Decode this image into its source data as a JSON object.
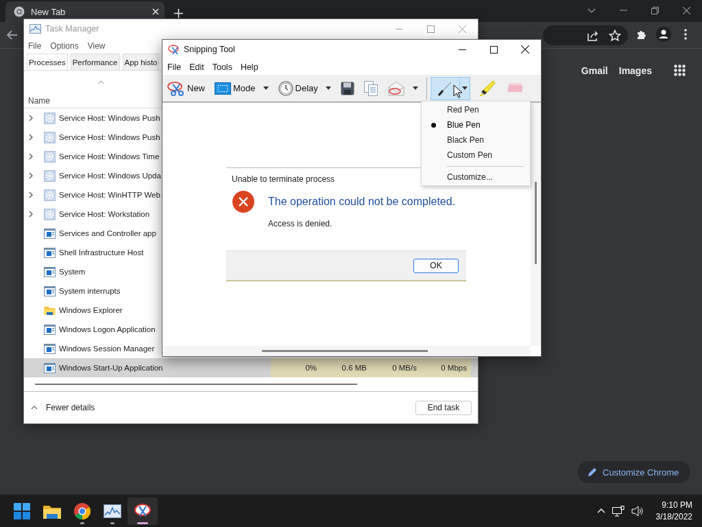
{
  "browser": {
    "tab": {
      "title": "New Tab"
    },
    "links": [
      "Gmail",
      "Images"
    ],
    "customize_button": "Customize Chrome"
  },
  "task_manager": {
    "title": "Task Manager",
    "menu": [
      "File",
      "Options",
      "View"
    ],
    "tabs": [
      {
        "label": "Processes",
        "selected": true
      },
      {
        "label": "Performance",
        "selected": false
      },
      {
        "label": "App histo",
        "selected": false
      }
    ],
    "column": "Name",
    "rows": [
      {
        "name": "Service Host: Windows Push",
        "kind": "service",
        "expandable": true,
        "selected": false
      },
      {
        "name": "Service Host: Windows Push",
        "kind": "service",
        "expandable": true,
        "selected": false
      },
      {
        "name": "Service Host: Windows Time",
        "kind": "service",
        "expandable": true,
        "selected": false
      },
      {
        "name": "Service Host: Windows Upda",
        "kind": "service",
        "expandable": true,
        "selected": false
      },
      {
        "name": "Service Host: WinHTTP Web",
        "kind": "service",
        "expandable": true,
        "selected": false
      },
      {
        "name": "Service Host: Workstation",
        "kind": "service",
        "expandable": true,
        "selected": false
      },
      {
        "name": "Services and Controller app",
        "kind": "app",
        "expandable": false,
        "selected": false
      },
      {
        "name": "Shell Infrastructure Host",
        "kind": "app",
        "expandable": false,
        "selected": false
      },
      {
        "name": "System",
        "kind": "app",
        "expandable": false,
        "selected": false
      },
      {
        "name": "System interrupts",
        "kind": "app",
        "expandable": false,
        "selected": false
      },
      {
        "name": "Windows Explorer",
        "kind": "folder",
        "expandable": false,
        "selected": false
      },
      {
        "name": "Windows Logon Application",
        "kind": "app",
        "expandable": false,
        "selected": false
      },
      {
        "name": "Windows Session Manager",
        "kind": "app",
        "expandable": false,
        "selected": false
      },
      {
        "name": "Windows Start-Up Application",
        "kind": "app",
        "expandable": false,
        "selected": true,
        "values": [
          "0%",
          "0.6 MB",
          "0 MB/s",
          "0 Mbps"
        ]
      }
    ],
    "footer": {
      "toggle": "Fewer details",
      "button": "End task"
    }
  },
  "snipping_tool": {
    "title": "Snipping Tool",
    "menu": [
      "File",
      "Edit",
      "Tools",
      "Help"
    ],
    "toolbar": [
      {
        "kind": "new",
        "label": "New",
        "dropdown": false
      },
      {
        "kind": "mode",
        "label": "Mode",
        "dropdown": true
      },
      {
        "kind": "delay",
        "label": "Delay",
        "dropdown": true
      },
      {
        "kind": "save",
        "dropdown": false
      },
      {
        "kind": "copy",
        "dropdown": false
      },
      {
        "kind": "send",
        "dropdown": true
      }
    ],
    "pen_tools": [
      {
        "kind": "pen",
        "dropdown": true,
        "pressed": true
      },
      {
        "kind": "highlighter",
        "dropdown": false,
        "pressed": false
      },
      {
        "kind": "eraser",
        "dropdown": false,
        "pressed": false
      }
    ],
    "pen_menu": {
      "items": [
        {
          "label": "Red Pen",
          "selected": false
        },
        {
          "label": "Blue Pen",
          "selected": true
        },
        {
          "label": "Black Pen",
          "selected": false
        },
        {
          "label": "Custom Pen",
          "selected": false
        }
      ],
      "customize": "Customize..."
    },
    "dialog": {
      "title": "Unable to terminate process",
      "heading": "The operation could not be completed.",
      "message": "Access is denied.",
      "button": "OK"
    }
  },
  "taskbar": {
    "apps": [
      {
        "kind": "start",
        "running": false,
        "active": false
      },
      {
        "kind": "explorer",
        "running": false,
        "active": false
      },
      {
        "kind": "chrome",
        "running": true,
        "active": false
      },
      {
        "kind": "taskmanager",
        "running": true,
        "active": false
      },
      {
        "kind": "snipping",
        "running": true,
        "active": true
      }
    ],
    "time": "9:10 PM",
    "date": "3/18/2022"
  }
}
